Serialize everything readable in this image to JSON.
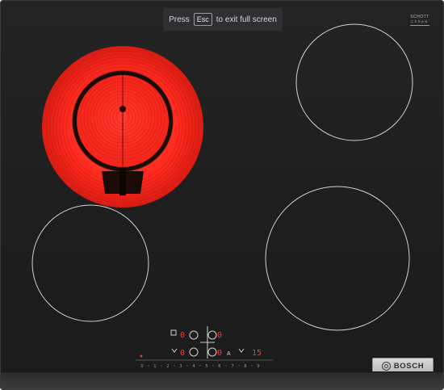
{
  "image": {
    "subject": "black ceramic glass cooktop with one glowing red dual-circuit heating zone",
    "colors": {
      "glass": "#1f1f1f",
      "zone_outline": "#d2d2d2",
      "glow_red": "#ff2a1f",
      "display_red": "#ff3a2a"
    }
  },
  "fullscreen_hint": {
    "prefix": "Press",
    "key": "Esc",
    "suffix": "to exit full screen"
  },
  "label_top_right": {
    "line1": "SCHOTT",
    "line2": "CERAN"
  },
  "controls": {
    "top_left_digit": "0",
    "top_right_digit": "0",
    "bottom_left_digit": "0",
    "bottom_right_digit": "0",
    "timer_label": "A",
    "timer_value": "15",
    "icons": [
      "dual-zone-icon",
      "zone-select-icon",
      "childlock-icon",
      "timer-icon"
    ]
  },
  "power_scale": [
    "0",
    "1",
    "2",
    "3",
    "4",
    "5",
    "6",
    "7",
    "8",
    "9"
  ],
  "brand": "BOSCH"
}
